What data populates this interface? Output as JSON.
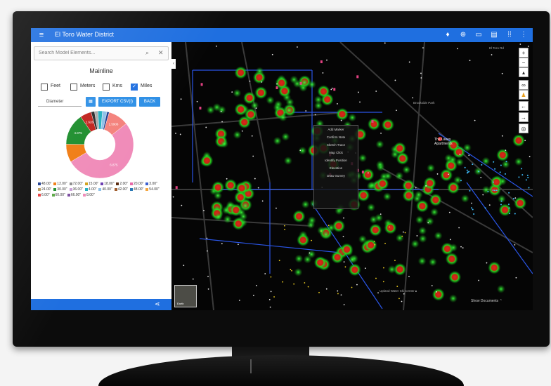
{
  "app": {
    "title": "El Toro Water District"
  },
  "appbar_icons": [
    "bell-icon",
    "add-icon",
    "window-icon",
    "print-icon",
    "apps-icon",
    "more-vert-icon"
  ],
  "search": {
    "placeholder": "Search Model Elements..."
  },
  "panel": {
    "title": "Mainline",
    "units": [
      {
        "label": "Feet",
        "checked": false
      },
      {
        "label": "Meters",
        "checked": false
      },
      {
        "label": "Kms",
        "checked": false
      },
      {
        "label": "Miles",
        "checked": true
      }
    ],
    "group_by": "Diameter",
    "export_label": "EXPORT CSV(I)",
    "back_label": "BACK"
  },
  "chart_data": {
    "type": "pie",
    "style": "donut",
    "slice_labels": [
      "6.875",
      "4.875",
      "1.626",
      "1.5906"
    ],
    "legend": [
      {
        "label": "48.00\"",
        "color": "#1a3a8f"
      },
      {
        "label": "12.00\"",
        "color": "#f07a10"
      },
      {
        "label": "72.00\"",
        "color": "#8c8c8c"
      },
      {
        "label": "15.00\"",
        "color": "#d2a21a"
      },
      {
        "label": "18.00\"",
        "color": "#6a3cb0"
      },
      {
        "label": "2.00\"",
        "color": "#5a2a10"
      },
      {
        "label": "20.00\"",
        "color": "#e86aa8"
      },
      {
        "label": "3.00\"",
        "color": "#3a5fd0"
      },
      {
        "label": "24.00\"",
        "color": "#b89b5e"
      },
      {
        "label": "30.00\"",
        "color": "#1a8c2a"
      },
      {
        "label": "36.00\"",
        "color": "#c8a0d8"
      },
      {
        "label": "4.00\"",
        "color": "#20b0c0"
      },
      {
        "label": "40.00\"",
        "color": "#8cc0e8"
      },
      {
        "label": "42.00\"",
        "color": "#a05c2c"
      },
      {
        "label": "48.00\"",
        "color": "#2a78b4"
      },
      {
        "label": "54.00\"",
        "color": "#f4a640"
      },
      {
        "label": "6.00\"",
        "color": "#e83a3a"
      },
      {
        "label": "60.00\"",
        "color": "#5aa844"
      },
      {
        "label": "66.00\"",
        "color": "#7a4aa0"
      },
      {
        "label": "8.00\"",
        "color": "#f08ab8"
      }
    ],
    "slices": [
      {
        "label": "6.875",
        "value": 48,
        "color": "#f08ab8"
      },
      {
        "label": "",
        "value": 8,
        "color": "#f07a10"
      },
      {
        "label": "4.875",
        "value": 14,
        "color": "#1a8c2a"
      },
      {
        "label": "1.626",
        "value": 5,
        "color": "#c0201a"
      },
      {
        "label": "",
        "value": 1.5,
        "color": "#2a2a2a"
      },
      {
        "label": "",
        "value": 1.5,
        "color": "#aaaaaa"
      },
      {
        "label": "",
        "value": 2,
        "color": "#20b0c0"
      },
      {
        "label": "",
        "value": 2,
        "color": "#8cc0e8"
      },
      {
        "label": "",
        "value": 1,
        "color": "#1a3a8f"
      },
      {
        "label": "1.5906",
        "value": 9,
        "color": "#f4807a"
      }
    ]
  },
  "map": {
    "popup_items": [
      "Add Marker",
      "Confirm Note",
      "Sketch Trace",
      "Map Click",
      "Identify Position",
      "Elevation",
      "Draw Survey"
    ],
    "labels": {
      "park": "Upland Water Ski Center",
      "apartments": "The Lakes Apartments",
      "school": "Brookside Park",
      "street": "El Toro Rd"
    },
    "basemap_label": "Earth",
    "show_documents": "Show Documents"
  },
  "colors": {
    "accent": "#1f6fe0",
    "button": "#2d8fe6",
    "heat_hot": "#d42020",
    "heat_warm": "#22d422"
  }
}
